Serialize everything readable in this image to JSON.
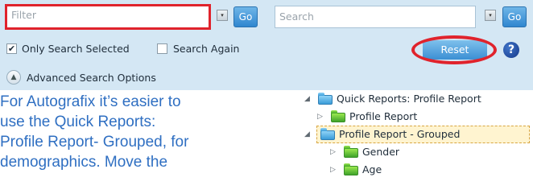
{
  "search_panel": {
    "filter_placeholder": "Filter",
    "search_placeholder": "Search",
    "go_label": "Go",
    "dropdown_glyph": "▾",
    "only_search_selected_label": "Only Search Selected",
    "only_search_selected_checked": true,
    "search_again_label": "Search Again",
    "search_again_checked": false,
    "reset_label": "Reset",
    "help_glyph": "?",
    "advanced_label": "Advanced Search Options"
  },
  "instructions": {
    "lines": [
      "For Autografix it’s easier to",
      "use the Quick Reports:",
      "Profile Report- Grouped, for",
      "demographics.  Move the"
    ]
  },
  "tree": {
    "root": "Quick Reports: Profile Report",
    "items": [
      "Profile Report",
      "Profile Report - Grouped",
      "Gender",
      "Age"
    ],
    "selected": "Profile Report - Grouped"
  },
  "colors": {
    "panel_bg": "#d4e7f4",
    "highlight_red": "#e0232c",
    "text_blue": "#2f6fc2",
    "button_blue": "#3b8fd3"
  }
}
